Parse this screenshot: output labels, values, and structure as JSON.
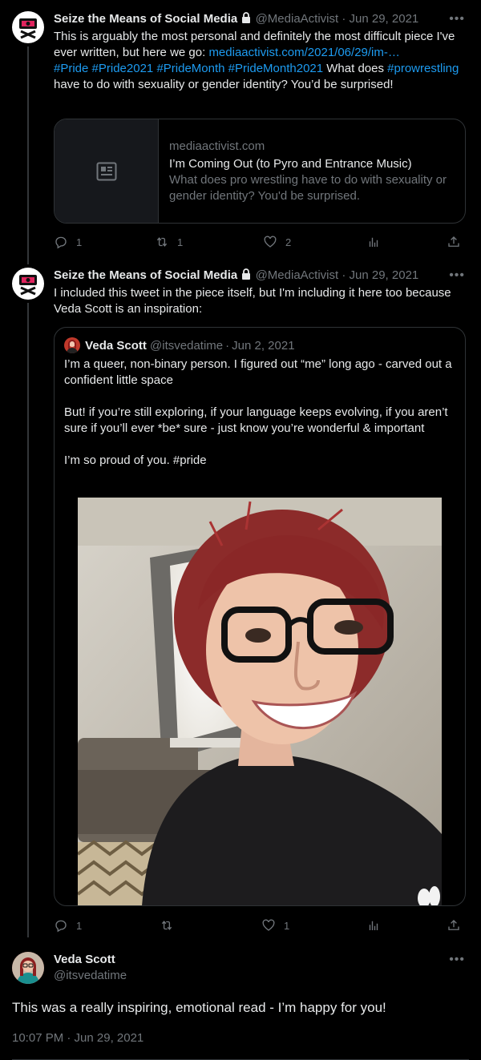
{
  "tweet1": {
    "name": "Seize the Means of Social Media",
    "handle": "@MediaActivist",
    "dot": "·",
    "date": "Jun 29, 2021",
    "text_1": "This is arguably the most personal and definitely the most difficult piece I've ever written, but here we go: ",
    "link": "mediaactivist.com/2021/06/29/im-…",
    "tag1": "#Pride",
    "tag2": "#Pride2021",
    "tag3": "#PrideMonth",
    "tag4": "#PrideMonth2021",
    "text_2": " What does ",
    "tag5": "#prowrestling",
    "text_3": " have to do with sexuality or gender identity? You’d be surprised!",
    "card": {
      "domain": "mediaactivist.com",
      "title": "I’m Coming Out (to Pyro and Entrance Music)",
      "description": "What does pro wrestling have to do with sexuality or gender identity? You'd be surprised."
    },
    "replies": "1",
    "retweets": "1",
    "likes": "2"
  },
  "tweet2": {
    "name": "Seize the Means of Social Media",
    "handle": "@MediaActivist",
    "dot": "·",
    "date": "Jun 29, 2021",
    "text": "I included this tweet in the piece itself, but I'm including it here too because Veda Scott is an inspiration:",
    "quote": {
      "name": "Veda Scott",
      "handle": "@itsvedatime",
      "dot": "·",
      "date": "Jun 2, 2021",
      "p1": "I’m a queer, non-binary person. I figured out “me” long ago - carved out a confident little space",
      "p2": "But! if you’re still exploring, if your language keeps evolving, if you aren’t sure if you’ll ever *be* sure - just know you’re wonderful & important",
      "p3_text": "I’m so proud of you.  ",
      "p3_tag": "#pride"
    },
    "replies": "1",
    "retweets": "",
    "likes": "1"
  },
  "tweet3": {
    "name": "Veda Scott",
    "handle": "@itsvedatime",
    "text": "This was a really inspiring, emotional read - I’m happy for you!",
    "timestamp": "10:07 PM · Jun 29, 2021"
  },
  "icons": {
    "more": "more-icon",
    "reply": "reply-icon",
    "retweet": "retweet-icon",
    "like": "heart-icon",
    "analytics": "analytics-icon",
    "share": "share-icon",
    "lock": "lock-icon",
    "article": "article-icon"
  },
  "colors": {
    "background": "#000000",
    "text": "#e7e9ea",
    "secondary": "#71767b",
    "link": "#1d9bf0",
    "border": "#2f3336"
  }
}
